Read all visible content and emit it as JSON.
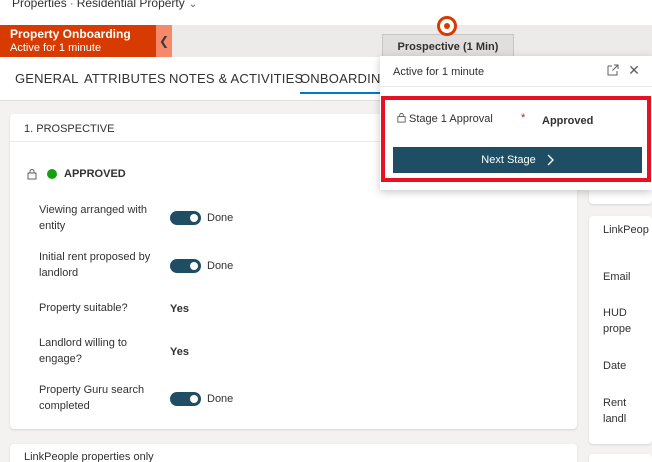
{
  "breadcrumb": {
    "entity": "Properties",
    "separator": "·",
    "form": "Residential Property",
    "form_chevron": "chevron-down-icon"
  },
  "bpf": {
    "process_name": "Property Onboarding",
    "process_status": "Active for 1 minute",
    "collapse_icon": "chevron-left-icon",
    "stage_name": "Prospective",
    "stage_duration": "(1 Min)"
  },
  "tabs": [
    "GENERAL",
    "ATTRIBUTES",
    "NOTES & ACTIVITIES",
    "ONBOARDING"
  ],
  "active_tab": "ONBOARDING",
  "main_section": {
    "title": "1. PROSPECTIVE",
    "status_text": "APPROVED",
    "status_color": "#13a10e",
    "fields": [
      {
        "label": "Viewing arranged with entity",
        "type": "toggle",
        "value": "Done",
        "on": true
      },
      {
        "label": "Initial rent proposed by landlord",
        "type": "toggle",
        "value": "Done",
        "on": true
      },
      {
        "label": "Property suitable?",
        "type": "text",
        "value": "Yes"
      },
      {
        "label": "Landlord willing to engage?",
        "type": "text",
        "value": "Yes"
      },
      {
        "label": "Property Guru search completed",
        "type": "toggle",
        "value": "Done",
        "on": true
      }
    ]
  },
  "bottom_section": {
    "title": "LinkPeople properties only"
  },
  "right_panel": {
    "title": "LinkPeop",
    "labels": [
      "Email",
      "HUD",
      "prope",
      "Date",
      "Rent",
      "landl"
    ]
  },
  "flyout": {
    "active_text": "Active for 1 minute",
    "popout_icon": "popout-icon",
    "close_icon": "close-icon",
    "field_label": "Stage 1 Approval",
    "required_mark": "*",
    "field_value": "Approved",
    "next_button": "Next Stage"
  },
  "colors": {
    "accent": "#d83b01",
    "button": "#1f4e64",
    "tab_underline": "#0078d4",
    "highlight": "#e81123"
  }
}
